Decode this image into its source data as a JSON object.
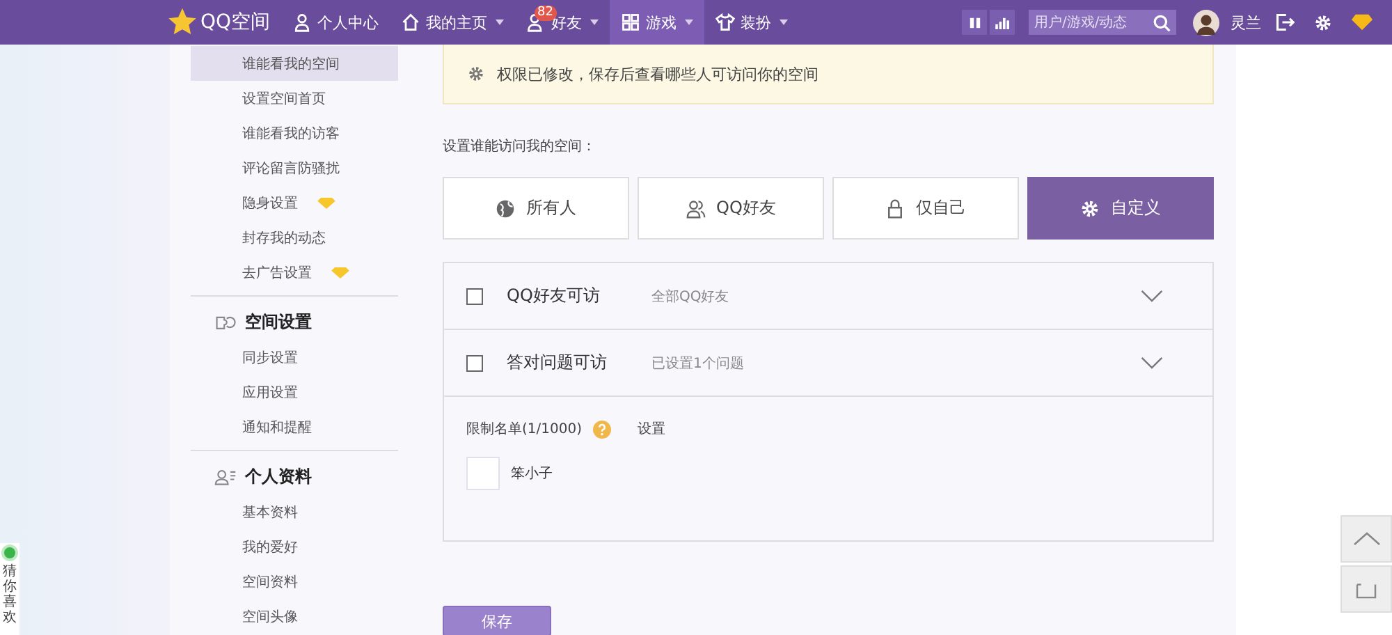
{
  "nav": {
    "logo": "QQ空间",
    "items": [
      {
        "label": "个人中心",
        "kind": "person",
        "dropdown": false,
        "selected": false
      },
      {
        "label": "我的主页",
        "kind": "home",
        "dropdown": true,
        "selected": false
      },
      {
        "label": "好友",
        "kind": "friends",
        "dropdown": true,
        "badge": "82",
        "selected": false
      },
      {
        "label": "游戏",
        "kind": "grid",
        "dropdown": true,
        "selected": true
      },
      {
        "label": "装扮",
        "kind": "shirt",
        "dropdown": true,
        "selected": false
      }
    ],
    "search": {
      "placeholder": "用户/游戏/动态"
    },
    "user": "灵兰"
  },
  "sidebar": {
    "groups": [
      {
        "items": [
          {
            "label": "谁能看我的空间",
            "selected": true,
            "vip": false
          },
          {
            "label": "设置空间首页",
            "selected": false,
            "vip": false
          },
          {
            "label": "谁能看我的访客",
            "selected": false,
            "vip": false
          },
          {
            "label": "评论留言防骚扰",
            "selected": false,
            "vip": false
          },
          {
            "label": "隐身设置",
            "selected": false,
            "vip": true
          },
          {
            "label": "封存我的动态",
            "selected": false,
            "vip": false
          },
          {
            "label": "去广告设置",
            "selected": false,
            "vip": true
          }
        ]
      },
      {
        "title": "空间设置",
        "kind": "sync",
        "items": [
          {
            "label": "同步设置",
            "selected": false,
            "vip": false
          },
          {
            "label": "应用设置",
            "selected": false,
            "vip": false
          },
          {
            "label": "通知和提醒",
            "selected": false,
            "vip": false
          }
        ]
      },
      {
        "title": "个人资料",
        "kind": "profile",
        "items": [
          {
            "label": "基本资料",
            "selected": false,
            "vip": false
          },
          {
            "label": "我的爱好",
            "selected": false,
            "vip": false
          },
          {
            "label": "空间资料",
            "selected": false,
            "vip": false
          },
          {
            "label": "空间头像",
            "selected": false,
            "vip": false
          }
        ]
      }
    ]
  },
  "notice": "权限已修改，保存后查看哪些人可访问你的空间",
  "prompt": "设置谁能访问我的空间：",
  "options": [
    {
      "label": "所有人",
      "kind": "globe",
      "selected": false
    },
    {
      "label": "QQ好友",
      "kind": "friends",
      "selected": false
    },
    {
      "label": "仅自己",
      "kind": "lock",
      "selected": false
    },
    {
      "label": "自定义",
      "kind": "gear",
      "selected": true
    }
  ],
  "rules": [
    {
      "label": "QQ好友可访",
      "detail": "全部QQ好友",
      "checked": false,
      "expanded": false
    },
    {
      "label": "答对问题可访",
      "detail": "已设置1个问题",
      "checked": false,
      "expanded": false
    }
  ],
  "restrict": {
    "label": "限制名单(1/1000)",
    "link": "设置",
    "members": [
      {
        "name": "笨小子"
      }
    ]
  },
  "save": "保存",
  "side_widget": "猜你喜欢"
}
